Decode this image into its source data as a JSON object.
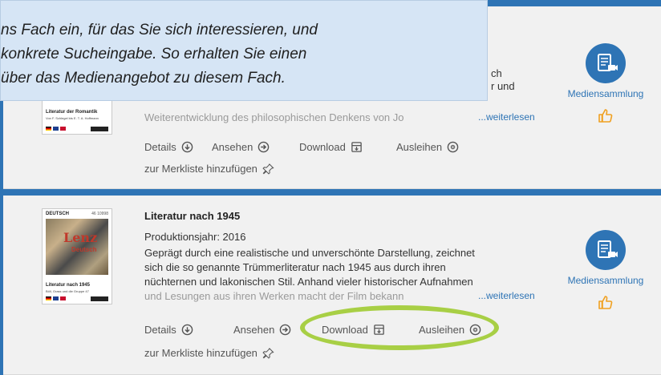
{
  "tooltip": {
    "lines": [
      "ns Fach ein, für das Sie sich interessieren, und",
      "konkrete Sucheingabe. So erhalten Sie einen",
      "über das Medienangebot zu diesem Fach."
    ]
  },
  "result_1": {
    "cover_title": "Literatur der Romantik",
    "cover_sub": "Von F. Schlegel bis E. T. A. Hoffmann",
    "partial_text_right_1": "ch",
    "partial_text_right_2": "r und",
    "description": "Weiterentwicklung des philosophischen Denkens von Jo",
    "more": "...weiterlesen",
    "actions": {
      "details": "Details",
      "watch": "Ansehen",
      "download": "Download",
      "borrow": "Ausleihen"
    },
    "watchlist": "zur Merkliste hinzufügen",
    "media_label": "Mediensammlung"
  },
  "result_2": {
    "cover_series": "DEUTSCH",
    "cover_code": "46 10998",
    "cover_art_name": "Lenz",
    "cover_art_tag": "Deutsch",
    "cover_title": "Literatur nach 1945",
    "cover_sub": "Böll, Grass und die Gruppe 47",
    "title": "Literatur nach 1945",
    "year": "Produktionsjahr: 2016",
    "description_lines": [
      "Geprägt durch eine realistische und unverschönte Darstellung, zeichnet",
      "sich die so genannte Trümmerliteratur nach 1945 aus durch ihren",
      "nüchternen und lakonischen Stil. Anhand vieler historischer Aufnahmen"
    ],
    "description_faded": "und Lesungen aus ihren Werken macht der Film bekann",
    "more": "...weiterlesen",
    "actions": {
      "details": "Details",
      "watch": "Ansehen",
      "download": "Download",
      "borrow": "Ausleihen"
    },
    "watchlist": "zur Merkliste hinzufügen",
    "media_label": "Mediensammlung"
  },
  "colors": {
    "accent": "#2e74b5",
    "highlight": "#a8cf45",
    "thumb": "#f0a020"
  }
}
